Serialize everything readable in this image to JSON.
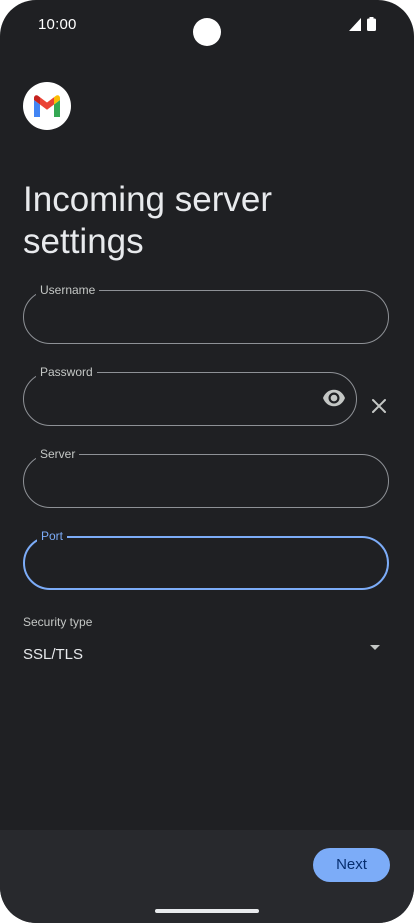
{
  "status_bar": {
    "time": "10:00"
  },
  "app": {
    "logo_icon": "gmail-icon"
  },
  "page": {
    "title": "Incoming server settings"
  },
  "form": {
    "username": {
      "label": "Username",
      "value": ""
    },
    "password": {
      "label": "Password",
      "value": ""
    },
    "server": {
      "label": "Server",
      "value": ""
    },
    "port": {
      "label": "Port",
      "value": ""
    },
    "security_type": {
      "label": "Security type",
      "value": "SSL/TLS"
    }
  },
  "actions": {
    "next_label": "Next"
  },
  "colors": {
    "background": "#1f2023",
    "accent": "#7cacf8",
    "bottom_bar": "#28292d"
  }
}
